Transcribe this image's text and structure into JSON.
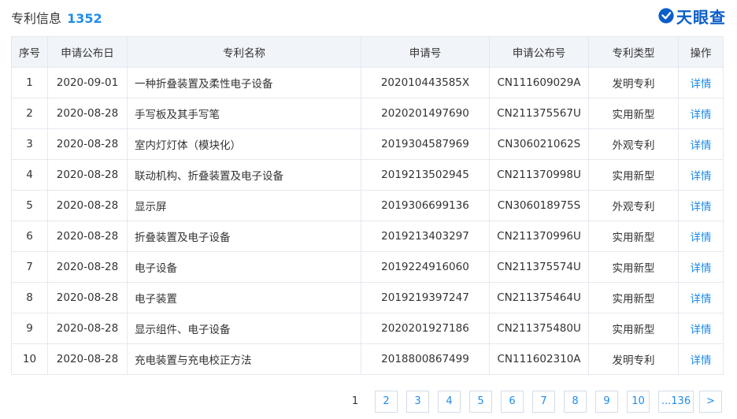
{
  "header": {
    "title": "专利信息",
    "count": "1352",
    "logo_text": "天眼查",
    "logo_icon": "tianyancha-logo-icon"
  },
  "table": {
    "columns": [
      "序号",
      "申请公布日",
      "专利名称",
      "申请号",
      "申请公布号",
      "专利类型",
      "操作"
    ],
    "rows": [
      {
        "no": "1",
        "date": "2020-09-01",
        "name": "一种折叠装置及柔性电子设备",
        "app_no": "202010443585X",
        "pub_no": "CN111609029A",
        "type": "发明专利",
        "action": "详情"
      },
      {
        "no": "2",
        "date": "2020-08-28",
        "name": "手写板及其手写笔",
        "app_no": "2020201497690",
        "pub_no": "CN211375567U",
        "type": "实用新型",
        "action": "详情"
      },
      {
        "no": "3",
        "date": "2020-08-28",
        "name": "室内灯灯体（模块化）",
        "app_no": "2019304587969",
        "pub_no": "CN306021062S",
        "type": "外观专利",
        "action": "详情"
      },
      {
        "no": "4",
        "date": "2020-08-28",
        "name": "联动机构、折叠装置及电子设备",
        "app_no": "2019213502945",
        "pub_no": "CN211370998U",
        "type": "实用新型",
        "action": "详情"
      },
      {
        "no": "5",
        "date": "2020-08-28",
        "name": "显示屏",
        "app_no": "2019306699136",
        "pub_no": "CN306018975S",
        "type": "外观专利",
        "action": "详情"
      },
      {
        "no": "6",
        "date": "2020-08-28",
        "name": "折叠装置及电子设备",
        "app_no": "2019213403297",
        "pub_no": "CN211370996U",
        "type": "实用新型",
        "action": "详情"
      },
      {
        "no": "7",
        "date": "2020-08-28",
        "name": "电子设备",
        "app_no": "2019224916060",
        "pub_no": "CN211375574U",
        "type": "实用新型",
        "action": "详情"
      },
      {
        "no": "8",
        "date": "2020-08-28",
        "name": "电子装置",
        "app_no": "2019219397247",
        "pub_no": "CN211375464U",
        "type": "实用新型",
        "action": "详情"
      },
      {
        "no": "9",
        "date": "2020-08-28",
        "name": "显示组件、电子设备",
        "app_no": "2020201927186",
        "pub_no": "CN211375480U",
        "type": "实用新型",
        "action": "详情"
      },
      {
        "no": "10",
        "date": "2020-08-28",
        "name": "充电装置与充电校正方法",
        "app_no": "2018800867499",
        "pub_no": "CN111602310A",
        "type": "发明专利",
        "action": "详情"
      }
    ]
  },
  "pagination": {
    "current": "1",
    "pages": [
      "2",
      "3",
      "4",
      "5",
      "6",
      "7",
      "8",
      "9",
      "10",
      "...136"
    ],
    "next_label": ">"
  },
  "colors": {
    "accent": "#1f8ceb",
    "logo": "#0a5ec8",
    "header_bg": "#f1f5fa",
    "border": "#e4e8ee"
  }
}
